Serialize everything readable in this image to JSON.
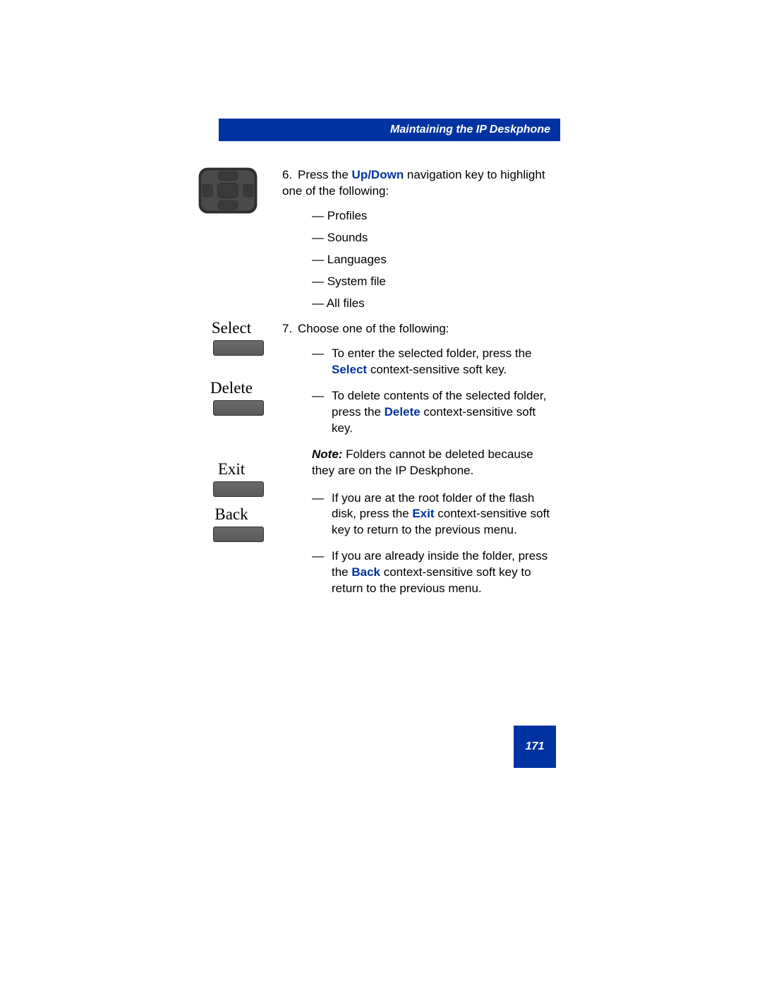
{
  "header": {
    "title": "Maintaining the IP Deskphone"
  },
  "softkeys": {
    "select": "Select",
    "delete": "Delete",
    "exit": "Exit",
    "back": "Back"
  },
  "step6": {
    "num": "6.",
    "lead1": "Press the ",
    "updown": "Up/Down",
    "lead2": " navigation key to highlight one of the following:",
    "items": {
      "a": "Profiles",
      "b": "Sounds",
      "c": " Languages",
      "d": "System file",
      "e": "All files"
    }
  },
  "step7": {
    "num": "7.",
    "lead": "Choose one of the following:",
    "opt1a": "To enter the selected folder, press the ",
    "opt1key": "Select",
    "opt1b": " context-sensitive soft key.",
    "opt2a": "To delete contents of the selected folder, press the ",
    "opt2key": "Delete",
    "opt2b": " context-sensitive soft key.",
    "note_label": "Note:",
    "note_text": "  Folders cannot be deleted because they are on the IP Deskphone.",
    "opt3a": "If you are at the root folder of the flash disk, press the ",
    "opt3key": "Exit",
    "opt3b": " context-sensitive soft key to return to the previous menu.",
    "opt4a": "If you are already inside the folder, press the ",
    "opt4key": "Back",
    "opt4b": " context-sensitive soft key to return to the previous menu."
  },
  "page_number": "171"
}
